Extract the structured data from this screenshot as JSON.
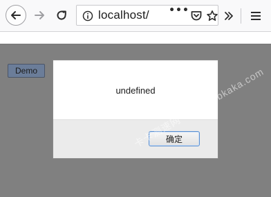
{
  "browser": {
    "url": "localhost/",
    "page_actions_label": "•••"
  },
  "page": {
    "demo_button_label": "Demo"
  },
  "dialog": {
    "message": "undefined",
    "ok_label": "确定"
  },
  "watermark": {
    "text": "卡卡测速网 www.webkaka.com"
  },
  "colors": {
    "overlay": "#808080",
    "dialog_footer": "#ebebeb",
    "focus_border": "#5a8fd1"
  }
}
